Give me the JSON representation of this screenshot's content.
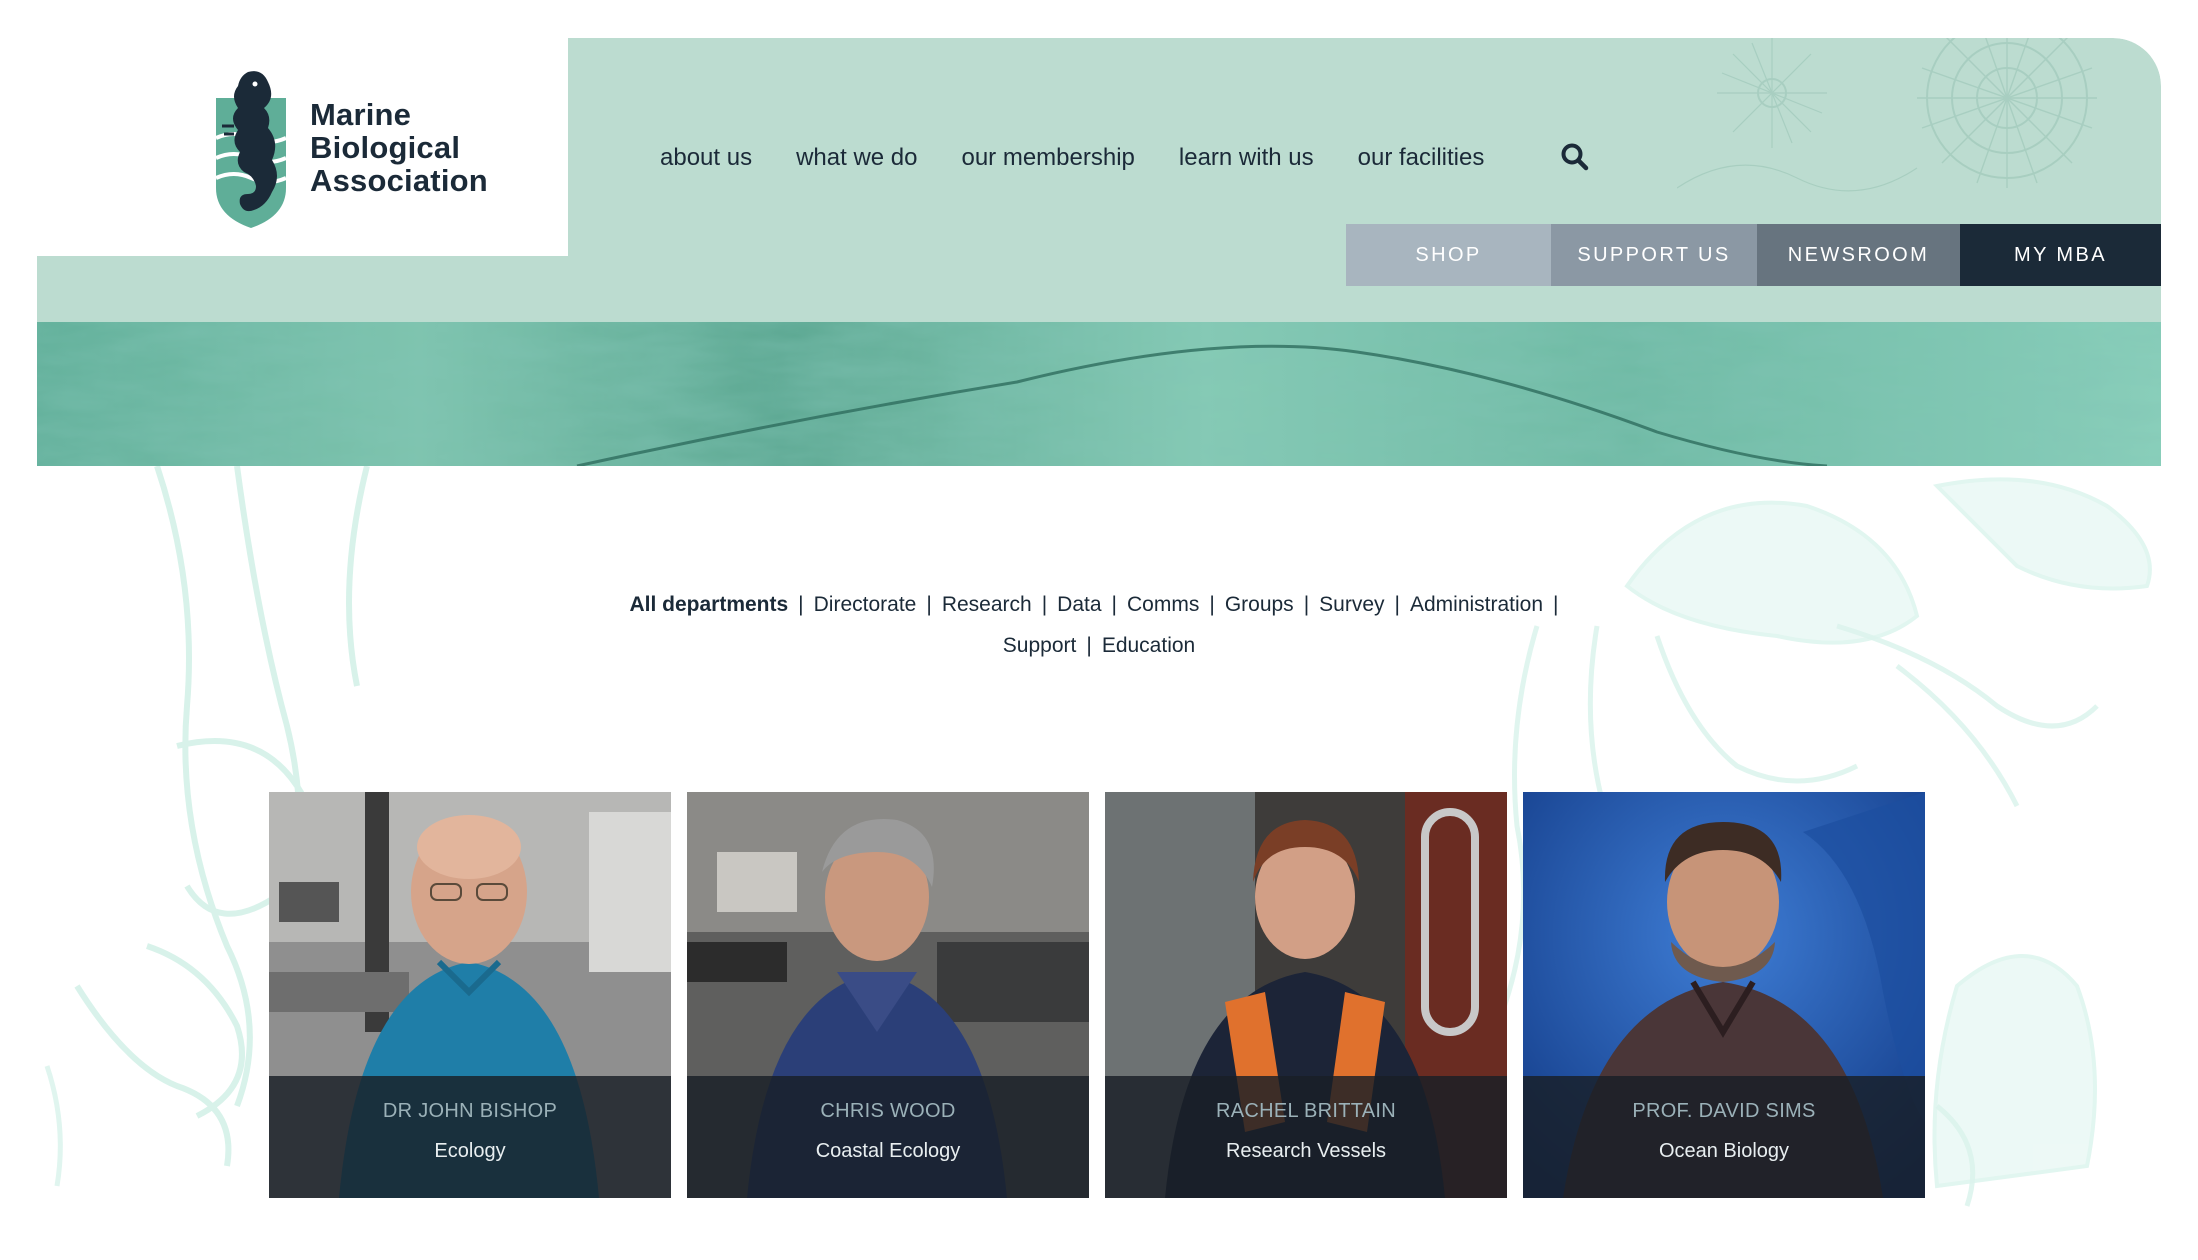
{
  "logo": {
    "lines": [
      "Marine",
      "Biological",
      "Association"
    ],
    "icon": "seahorse-icon"
  },
  "main_nav": [
    {
      "label": "about us"
    },
    {
      "label": "what we do"
    },
    {
      "label": "our membership"
    },
    {
      "label": "learn with us"
    },
    {
      "label": "our facilities"
    }
  ],
  "search": {
    "icon": "search-icon"
  },
  "utility_nav": [
    {
      "label": "SHOP",
      "color": "#a8b5bf"
    },
    {
      "label": "SUPPORT US",
      "color": "#8b98a4"
    },
    {
      "label": "NEWSROOM",
      "color": "#67747f"
    },
    {
      "label": "MY MBA",
      "color": "#1b2a38"
    }
  ],
  "colors": {
    "mint": "#bcdcd0",
    "hero_green": "#6db9a3",
    "navy": "#1b2a38"
  },
  "filters": {
    "row1": [
      {
        "label": "All departments",
        "active": true
      },
      {
        "label": "Directorate"
      },
      {
        "label": "Research"
      },
      {
        "label": "Data"
      },
      {
        "label": "Comms"
      },
      {
        "label": "Groups"
      },
      {
        "label": "Survey"
      },
      {
        "label": "Administration"
      }
    ],
    "row2": [
      {
        "label": "Support"
      },
      {
        "label": "Education"
      }
    ],
    "separator": "|"
  },
  "staff": [
    {
      "name": "DR JOHN BISHOP",
      "dept": "Ecology"
    },
    {
      "name": "CHRIS WOOD",
      "dept": "Coastal Ecology"
    },
    {
      "name": "RACHEL BRITTAIN",
      "dept": "Research Vessels"
    },
    {
      "name": "PROF. DAVID SIMS",
      "dept": "Ocean Biology"
    }
  ]
}
